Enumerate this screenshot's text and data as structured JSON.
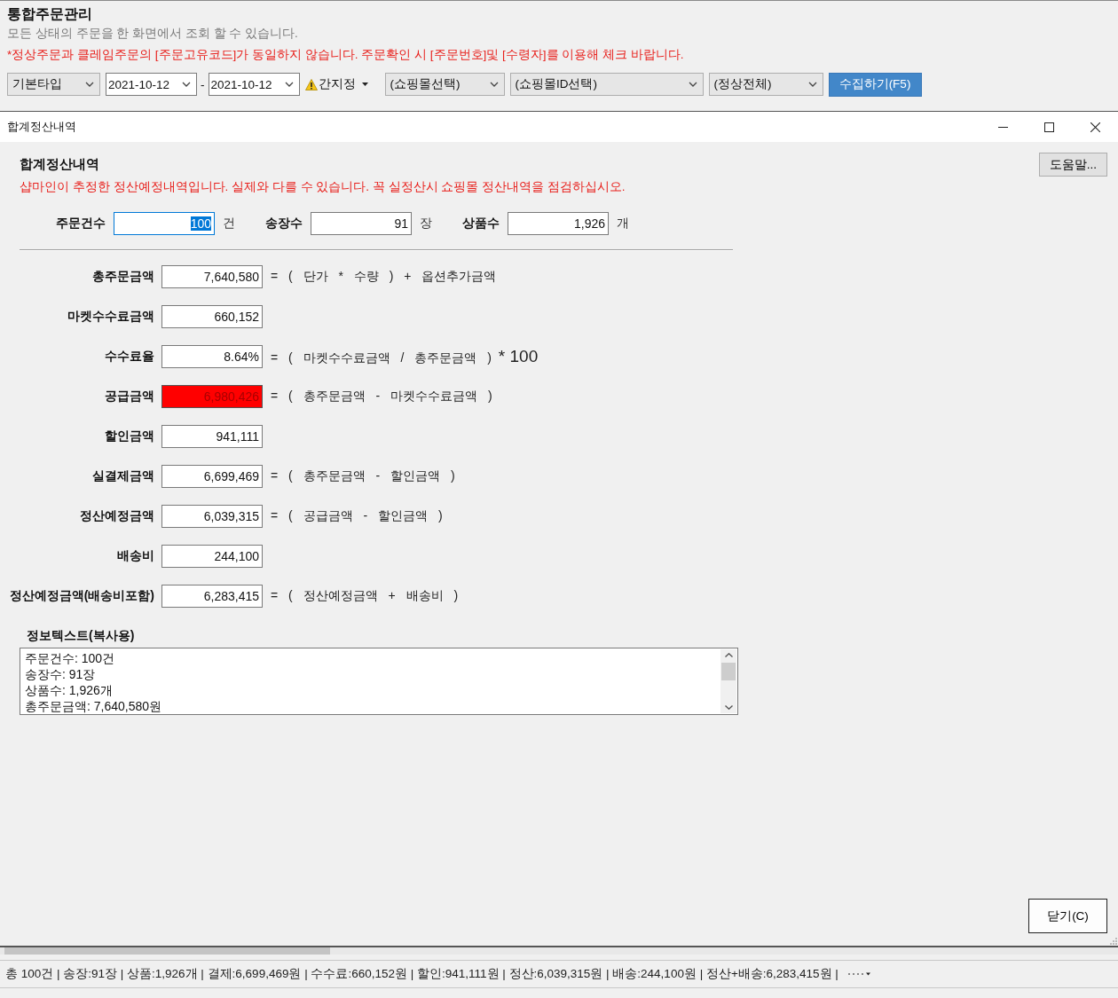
{
  "window": {
    "title": "통합주문관리",
    "subtitle": "모든 상태의 주문을 한 화면에서 조회 할 수 있습니다.",
    "warning": "*정상주문과 클레임주문의 [주문고유코드]가 동일하지 않습니다. 주문확인 시 [주문번호]및 [수령자]를 이용해 체크 바랍니다."
  },
  "toolbar": {
    "items": [
      {
        "kind": "dropdown",
        "value": "기본타입"
      },
      {
        "kind": "date",
        "value": "2021-10-12"
      },
      {
        "kind": "separator",
        "text": "-"
      },
      {
        "kind": "date",
        "value": "2021-10-12"
      },
      {
        "kind": "menu",
        "label": "간지정"
      },
      {
        "kind": "dropdown",
        "value": "(쇼핑몰선택)"
      },
      {
        "kind": "dropdown",
        "value": "(쇼핑몰ID선택)"
      },
      {
        "kind": "dropdown",
        "value": "(정상전체)"
      },
      {
        "kind": "button",
        "label": "수집하기(F5)"
      }
    ]
  },
  "dialog": {
    "title": "합계정산내역",
    "heading": "합계정산내역",
    "notice": "샵마인이 추정한 정산예정내역입니다. 실제와 다를 수 있습니다. 꼭 실정산시 쇼핑몰 정산내역을 점검하십시오.",
    "help_button": "도움말...",
    "counts": [
      {
        "label": "주문건수",
        "value": "100",
        "unit": "건",
        "focused": true
      },
      {
        "label": "송장수",
        "value": "91",
        "unit": "장",
        "focused": false
      },
      {
        "label": "상품수",
        "value": "1,926",
        "unit": "개",
        "focused": false
      }
    ],
    "amounts": [
      {
        "label": "총주문금액",
        "value": "7,640,580",
        "alert": false,
        "formula": "= ( 단가 * 수량 ) + 옵션추가금액"
      },
      {
        "label": "마켓수수료금액",
        "value": "660,152",
        "alert": false
      },
      {
        "label": "수수료율",
        "value": "8.64%",
        "alert": false,
        "formula": "= ( 마켓수수료금액 / 총주문금액 )",
        "multiplier": "* 100"
      },
      {
        "label": "공급금액",
        "value": "6,980,426",
        "alert": true,
        "formula": "= ( 총주문금액 - 마켓수수료금액 )"
      },
      {
        "label": "할인금액",
        "value": "941,111",
        "alert": false
      },
      {
        "label": "실결제금액",
        "value": "6,699,469",
        "alert": false,
        "formula": "= ( 총주문금액 - 할인금액 )"
      },
      {
        "label": "정산예정금액",
        "value": "6,039,315",
        "alert": false,
        "formula": "= ( 공급금액 - 할인금액 )"
      },
      {
        "label": "배송비",
        "value": "244,100",
        "alert": false
      },
      {
        "label": "정산예정금액(배송비포함)",
        "value": "6,283,415",
        "alert": false,
        "formula": "= ( 정산예정금액 + 배송비 )"
      }
    ],
    "info_text": {
      "label": "정보텍스트(복사용)",
      "lines": [
        "주문건수: 100건",
        "송장수: 91장",
        "상품수: 1,926개",
        "총주문금액: 7,640,580원"
      ]
    },
    "close_button": "닫기(C)"
  },
  "status_bar": {
    "text": "총 100건 | 송장:91장 | 상품:1,926개 | 결제:6,699,469원 | 수수료:660,152원 | 할인:941,111원 | 정산:6,039,315원 | 배송:244,100원 | 정산+배송:6,283,415원 |"
  }
}
